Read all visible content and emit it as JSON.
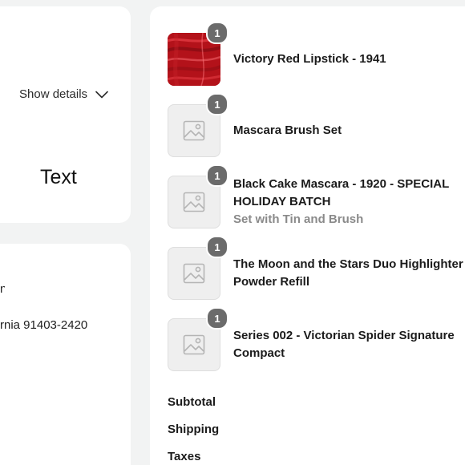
{
  "order_summary": {
    "toggle_label": "Show details",
    "toggle_icon": "chevron-down-icon",
    "placeholder_text": "Text"
  },
  "shipping_address": {
    "line_1": "n",
    "line_2": "rnia 91403-2420"
  },
  "line_items": [
    {
      "title": "Victory Red Lipstick - 1941",
      "variant": "",
      "quantity": "1",
      "image": "lipstick-photo"
    },
    {
      "title": "Mascara Brush Set",
      "variant": "",
      "quantity": "1",
      "image": "image-placeholder-icon"
    },
    {
      "title": "Black Cake Mascara - 1920 - SPECIAL HOLIDAY BATCH",
      "variant": "Set with Tin and Brush",
      "quantity": "1",
      "image": "image-placeholder-icon"
    },
    {
      "title": "The Moon and the Stars Duo Highlighter Powder Refill",
      "variant": "",
      "quantity": "1",
      "image": "image-placeholder-icon"
    },
    {
      "title": "Series 002 - Victorian Spider Signature Compact",
      "variant": "",
      "quantity": "1",
      "image": "image-placeholder-icon"
    }
  ],
  "totals": {
    "subtotal_label": "Subtotal",
    "shipping_label": "Shipping",
    "taxes_label": "Taxes"
  },
  "colors": {
    "background": "#f2f3f3",
    "card": "#ffffff",
    "quantity_badge": "#6b6b6b",
    "placeholder_bg": "#efefef",
    "variant_text": "#8a8a8a",
    "lipstick_red": "#b3121a"
  }
}
